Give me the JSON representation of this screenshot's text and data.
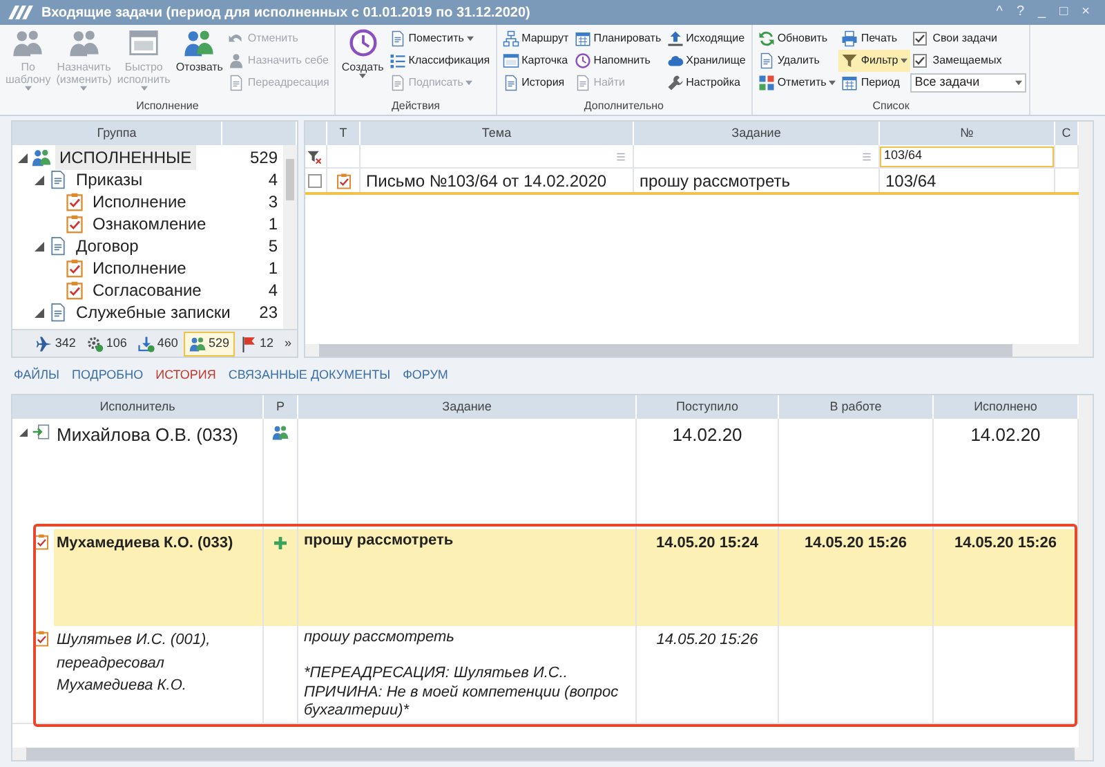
{
  "window": {
    "title": "Входящие задачи (период для исполненных с 01.01.2019 по 31.12.2020)",
    "controls": [
      "^",
      "?",
      "_",
      "□",
      "×"
    ]
  },
  "ribbon": {
    "groups": [
      {
        "label": "Исполнение",
        "columns": [
          {
            "kind": "large",
            "label": "По\nшаблону",
            "dropdown": true,
            "disabled": true
          },
          {
            "kind": "large",
            "label": "Назначить\n(изменить)",
            "dropdown": true,
            "disabled": true
          },
          {
            "kind": "large",
            "label": "Быстро\nисполнить",
            "dropdown": true,
            "disabled": true
          },
          {
            "kind": "large",
            "label": "Отозвать",
            "dropdown": false,
            "disabled": false
          },
          {
            "kind": "stack",
            "items": [
              {
                "kind": "button",
                "label": "Отменить",
                "dropdown": false,
                "disabled": true
              },
              {
                "kind": "button",
                "label": "Назначить себе",
                "dropdown": false,
                "disabled": true
              },
              {
                "kind": "button",
                "label": "Переадресация",
                "dropdown": false,
                "disabled": true
              }
            ]
          }
        ]
      },
      {
        "label": "Действия",
        "columns": [
          {
            "kind": "large",
            "label": "Создать",
            "dropdown": true,
            "disabled": false
          },
          {
            "kind": "stack",
            "items": [
              {
                "kind": "button",
                "label": "Поместить",
                "dropdown": true,
                "disabled": false
              },
              {
                "kind": "button",
                "label": "Классификация",
                "dropdown": false,
                "disabled": false
              },
              {
                "kind": "button",
                "label": "Подписать",
                "dropdown": true,
                "disabled": true
              }
            ]
          }
        ]
      },
      {
        "label": "Дополнительно",
        "columns": [
          {
            "kind": "stack",
            "items": [
              {
                "kind": "button",
                "label": "Маршрут",
                "dropdown": false,
                "disabled": false
              },
              {
                "kind": "button",
                "label": "Карточка",
                "dropdown": false,
                "disabled": false
              },
              {
                "kind": "button",
                "label": "История",
                "dropdown": false,
                "disabled": false
              }
            ]
          },
          {
            "kind": "stack",
            "items": [
              {
                "kind": "button",
                "label": "Планировать",
                "dropdown": false,
                "disabled": false
              },
              {
                "kind": "button",
                "label": "Напомнить",
                "dropdown": false,
                "disabled": false
              },
              {
                "kind": "button",
                "label": "Найти",
                "dropdown": false,
                "disabled": true
              }
            ]
          },
          {
            "kind": "stack",
            "items": [
              {
                "kind": "button",
                "label": "Исходящие",
                "dropdown": false,
                "disabled": false
              },
              {
                "kind": "button",
                "label": "Хранилище",
                "dropdown": false,
                "disabled": false
              },
              {
                "kind": "button",
                "label": "Настройка",
                "dropdown": false,
                "disabled": false
              }
            ]
          }
        ]
      },
      {
        "label": "Список",
        "columns": [
          {
            "kind": "stack",
            "items": [
              {
                "kind": "button",
                "label": "Обновить",
                "dropdown": false,
                "disabled": false,
                "active": false
              },
              {
                "kind": "button",
                "label": "Удалить",
                "dropdown": false,
                "disabled": false,
                "active": false
              },
              {
                "kind": "button",
                "label": "Отметить",
                "dropdown": true,
                "disabled": false,
                "active": false
              }
            ]
          },
          {
            "kind": "stack",
            "items": [
              {
                "kind": "button",
                "label": "Печать",
                "dropdown": false,
                "disabled": false,
                "active": false
              },
              {
                "kind": "button",
                "label": "Фильтр",
                "dropdown": true,
                "disabled": false,
                "active": true
              },
              {
                "kind": "button",
                "label": "Период",
                "dropdown": false,
                "disabled": false,
                "active": false
              }
            ]
          },
          {
            "kind": "stack",
            "items": [
              {
                "kind": "checkbox",
                "label": "Свои задачи",
                "checked": true
              },
              {
                "kind": "checkbox",
                "label": "Замещаемых",
                "checked": true
              },
              {
                "kind": "select",
                "value": "Все задачи"
              }
            ]
          }
        ]
      }
    ]
  },
  "tree": {
    "header": "Группа",
    "nodes": [
      {
        "kind": "root",
        "label": "ИСПОЛНЕННЫЕ",
        "count": "529",
        "selected": true,
        "expanded": true,
        "children": [
          {
            "kind": "category",
            "label": "Приказы",
            "count": "4",
            "selected": false,
            "expanded": true,
            "children": [
              {
                "kind": "task",
                "label": "Исполнение",
                "count": "3",
                "selected": false
              },
              {
                "kind": "task",
                "label": "Ознакомление",
                "count": "1",
                "selected": false
              }
            ]
          },
          {
            "kind": "category",
            "label": "Договор",
            "count": "5",
            "selected": false,
            "expanded": true,
            "children": [
              {
                "kind": "task",
                "label": "Исполнение",
                "count": "1",
                "selected": false
              },
              {
                "kind": "task",
                "label": "Согласование",
                "count": "4",
                "selected": false
              }
            ]
          },
          {
            "kind": "category",
            "label": "Служебные записки",
            "count": "23",
            "selected": false,
            "expanded": true
          }
        ]
      }
    ],
    "filters": [
      {
        "count": "342",
        "selected": false
      },
      {
        "count": "106",
        "selected": false
      },
      {
        "count": "460",
        "selected": false
      },
      {
        "count": "529",
        "selected": true
      },
      {
        "count": "12",
        "selected": false
      }
    ],
    "more": "»"
  },
  "grid": {
    "columns": [
      {
        "label": "Т"
      },
      {
        "label": "Тема"
      },
      {
        "label": "Задание"
      },
      {
        "label": "№",
        "filter": "103/64"
      },
      {
        "label": "С"
      }
    ],
    "rows": [
      {
        "checked": false,
        "selected": true,
        "cells": [
          "",
          "Письмо №103/64 от 14.02.2020",
          "прошу рассмотреть",
          "103/64"
        ]
      }
    ]
  },
  "tabs": [
    {
      "label": "ФАЙЛЫ",
      "selected": false
    },
    {
      "label": "ПОДРОБНО",
      "selected": false
    },
    {
      "label": "ИСТОРИЯ",
      "selected": true
    },
    {
      "label": "СВЯЗАННЫЕ ДОКУМЕНТЫ",
      "selected": false
    },
    {
      "label": "ФОРУМ",
      "selected": false
    }
  ],
  "history": {
    "columns": [
      "Исполнитель",
      "Р",
      "Задание",
      "Поступило",
      "В работе",
      "Исполнено"
    ],
    "rows": [
      {
        "kind": "group",
        "expanded": true,
        "executor": "Михайлова О.В. (033)",
        "received": "14.02.20",
        "done": "14.02.20",
        "highlighted": false,
        "marked": false
      },
      {
        "kind": "current",
        "executor": "Мухамедиева К.О. (033)",
        "task": "прошу рассмотреть",
        "received": "14.05.20 15:24",
        "in_work": "14.05.20 15:26",
        "done": "14.05.20 15:26",
        "highlighted": true,
        "marked": true
      },
      {
        "kind": "redirect",
        "executor": "Шулятьев И.С. (001), переадресовал Мухамедиева К.О.",
        "task": "прошу рассмотреть\n\n*ПЕРЕАДРЕСАЦИЯ: Шулятьев И.С..\nПРИЧИНА: Не в моей компетенции (вопрос бухгалтерии)*",
        "received": "14.05.20 15:26",
        "highlighted": false,
        "marked": true
      }
    ]
  }
}
